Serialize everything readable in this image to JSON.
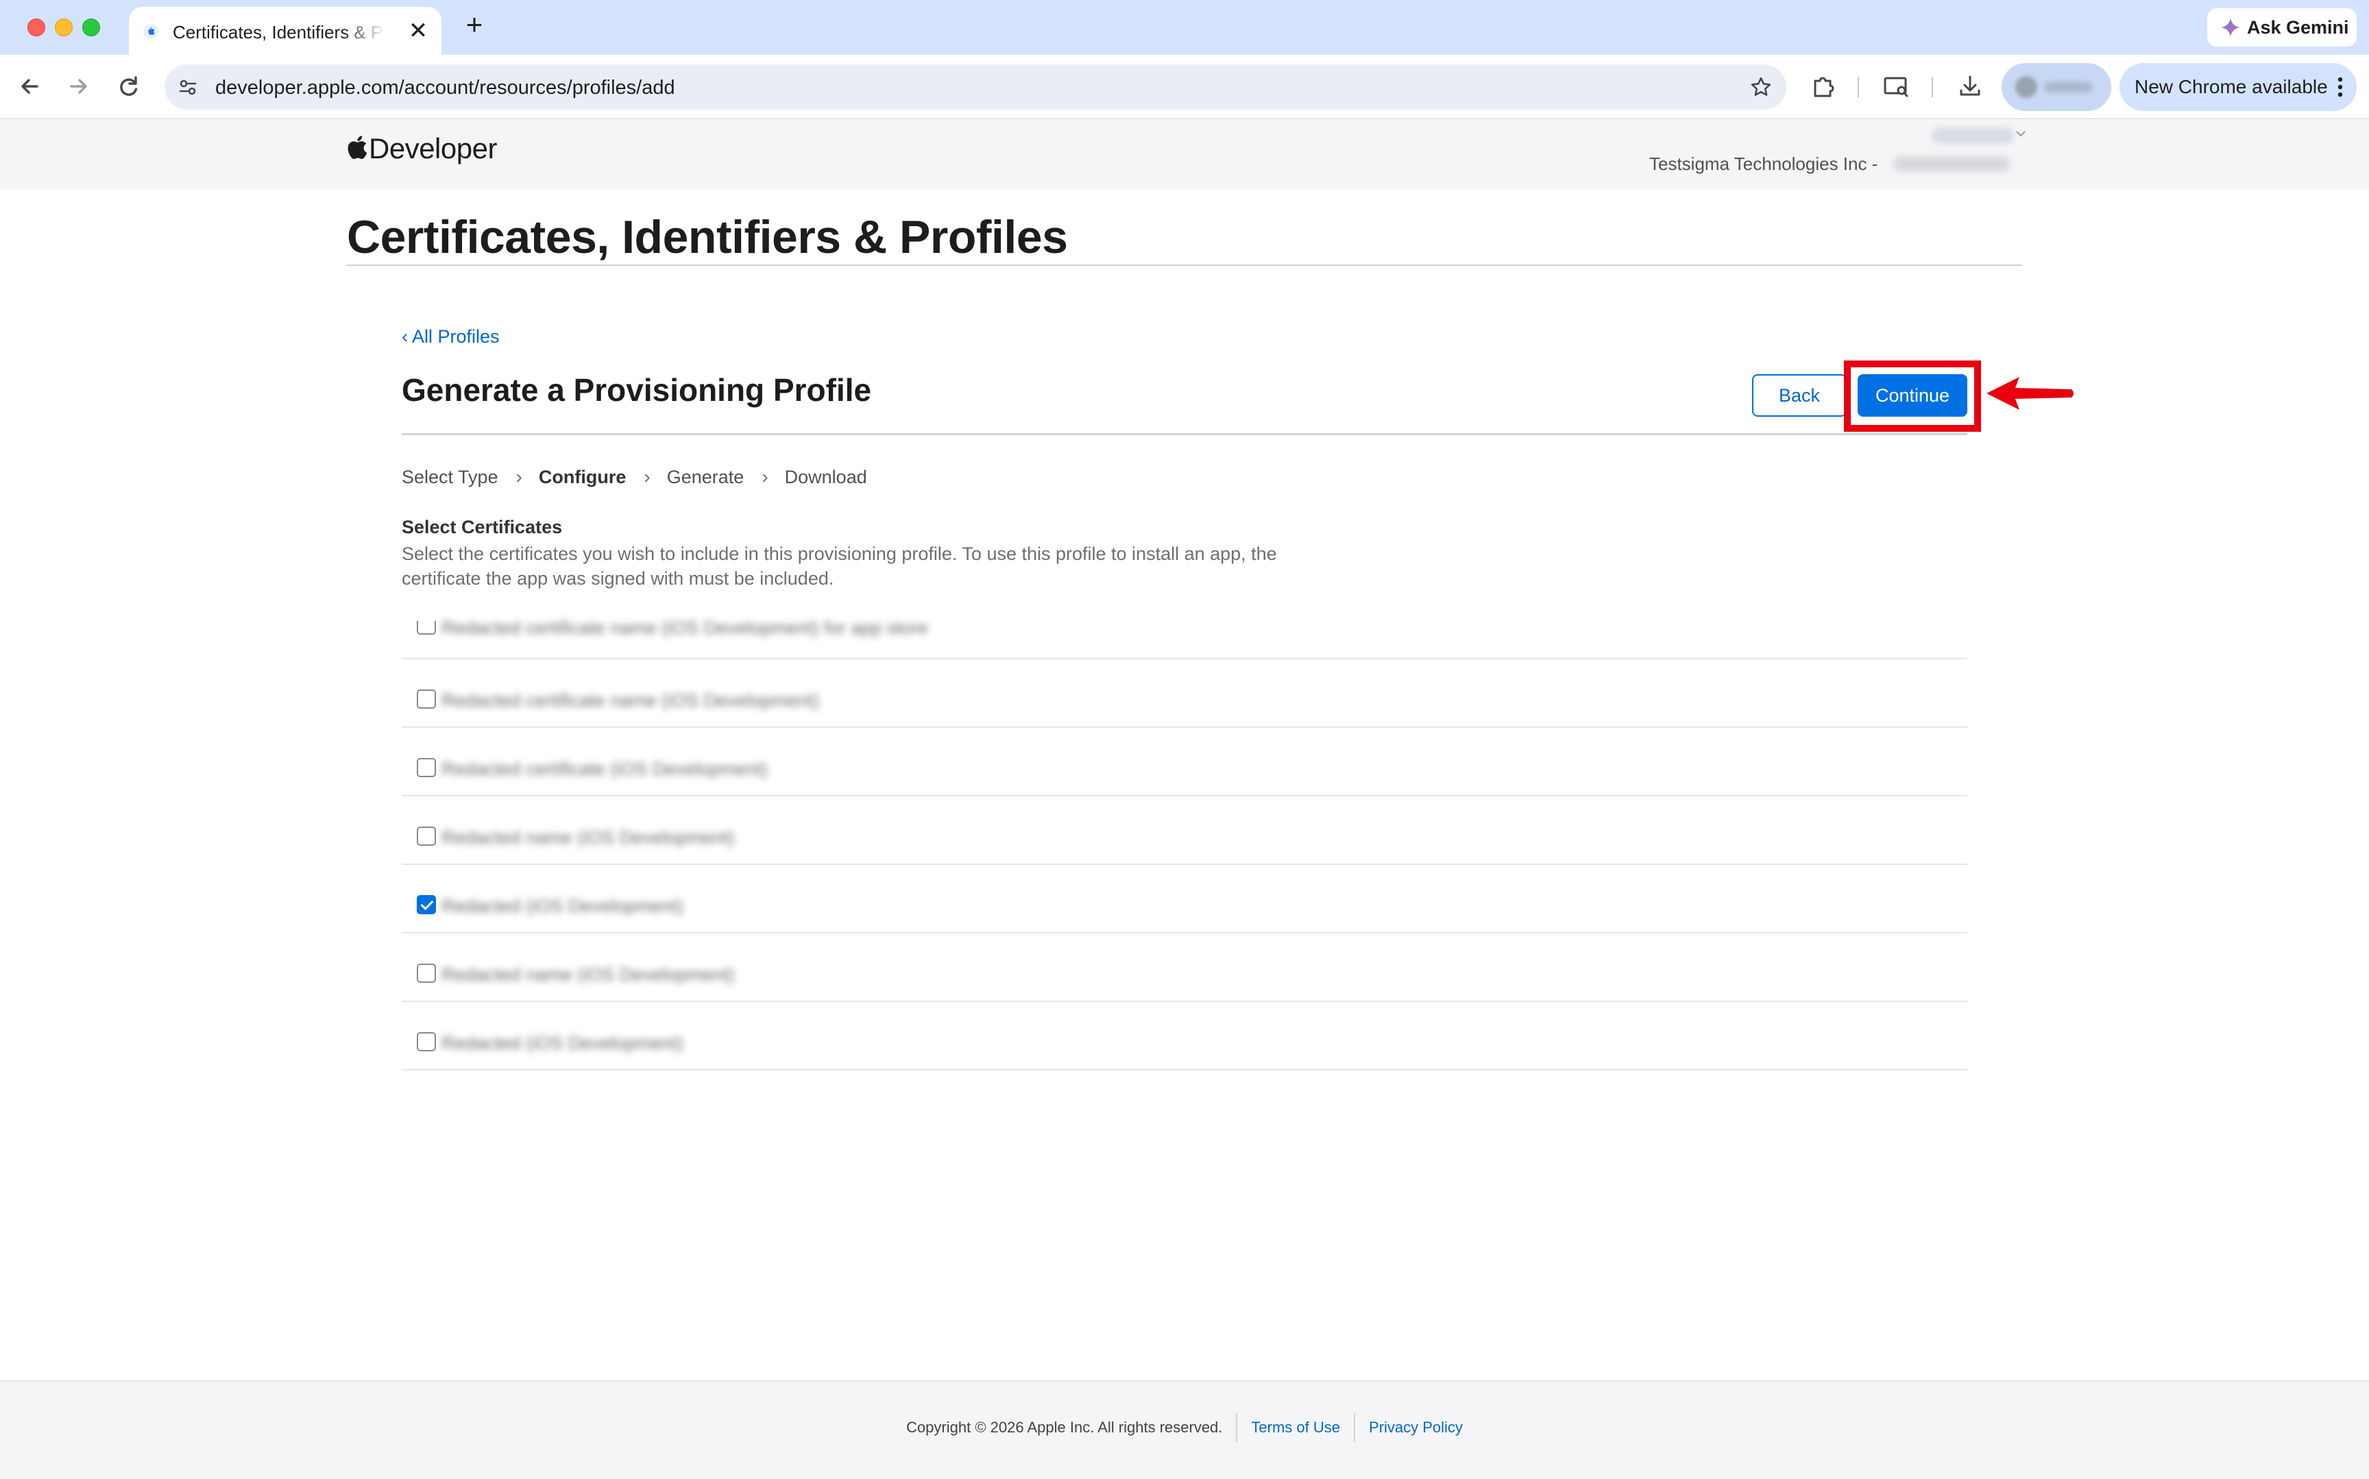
{
  "browser": {
    "tab_title": "Certificates, Identifiers & Profiles",
    "new_tab_symbol": "+",
    "close_symbol": "✕",
    "gemini_label": "Ask Gemini",
    "url": "developer.apple.com/account/resources/profiles/add",
    "update_label": "New Chrome available"
  },
  "header": {
    "logo_text": "Developer",
    "team_name": "Testsigma Technologies Inc -"
  },
  "page": {
    "title": "Certificates, Identifiers & Profiles",
    "back_link": "‹ All Profiles",
    "section_title": "Generate a Provisioning Profile",
    "back_button": "Back",
    "continue_button": "Continue",
    "steps": [
      {
        "label": "Select Type",
        "active": false
      },
      {
        "label": "Configure",
        "active": true
      },
      {
        "label": "Generate",
        "active": false
      },
      {
        "label": "Download",
        "active": false
      }
    ],
    "step_separator": "›",
    "certificates_heading": "Select Certificates",
    "certificates_description": "Select the certificates you wish to include in this provisioning profile. To use this profile to install an app, the certificate the app was signed with must be included."
  },
  "certificates": [
    {
      "label": "Redacted certificate name (iOS Development) for app store",
      "checked": false
    },
    {
      "label": "Redacted certificate name (iOS Development)",
      "checked": false
    },
    {
      "label": "Redacted certificate (iOS Development)",
      "checked": false
    },
    {
      "label": "Redacted name (iOS Development)",
      "checked": false
    },
    {
      "label": "Redacted (iOS Development)",
      "checked": true
    },
    {
      "label": "Redacted name (iOS Development)",
      "checked": false
    },
    {
      "label": "Redacted (iOS Development)",
      "checked": false
    }
  ],
  "footer": {
    "copyright": "Copyright © 2026 Apple Inc. All rights reserved.",
    "terms": "Terms of Use",
    "privacy": "Privacy Policy"
  },
  "colors": {
    "accent": "#0071e3",
    "link": "#0066cc",
    "annotation": "#e8000f",
    "tab_strip": "#d3e3fd"
  },
  "icons": [
    "apple-favicon-icon",
    "gemini-sparkle-icon",
    "back-arrow-icon",
    "forward-arrow-icon",
    "reload-icon",
    "site-settings-icon",
    "bookmark-star-icon",
    "extensions-icon",
    "cast-icon",
    "download-icon",
    "kebab-menu-icon",
    "apple-logo-icon",
    "red-arrow-icon"
  ]
}
